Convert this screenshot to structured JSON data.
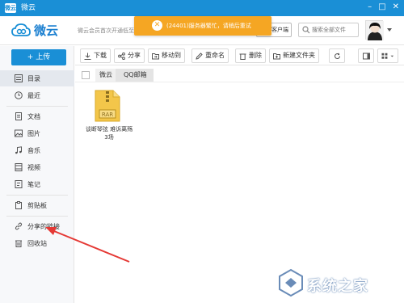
{
  "titlebar": {
    "app_icon": "微云",
    "title": "微云"
  },
  "header": {
    "logo_text": "微云",
    "promo": "微云会员首次开通低至一元",
    "client_button": "客户端",
    "search_placeholder": "搜索全部文件"
  },
  "toast": {
    "icon": "error-icon",
    "message": "(24401)服务器繁忙，请稍后重试",
    "color": "#f5a623"
  },
  "sidebar": {
    "upload_label": "+ 上传",
    "items": [
      {
        "label": "目录"
      },
      {
        "label": "最近"
      },
      {
        "label": "文档"
      },
      {
        "label": "图片"
      },
      {
        "label": "音乐"
      },
      {
        "label": "视频"
      },
      {
        "label": "笔记"
      },
      {
        "label": "剪贴板"
      },
      {
        "label": "分享的链接"
      },
      {
        "label": "回收站"
      }
    ]
  },
  "toolbar": {
    "download": "下载",
    "share": "分享",
    "move": "移动到",
    "rename": "重命名",
    "delete": "删除",
    "new_folder": "新建文件夹"
  },
  "breadcrumb": {
    "root": "微云",
    "current": "QQ邮箱"
  },
  "files": [
    {
      "type": "RAR",
      "name_line1": "谈断琴弦 难诉离殇",
      "name_line2": "3场"
    }
  ],
  "watermark": {
    "text": "系统之家"
  },
  "colors": {
    "accent": "#1a8fd6",
    "toast": "#f5a623",
    "arrow": "#e53935"
  }
}
